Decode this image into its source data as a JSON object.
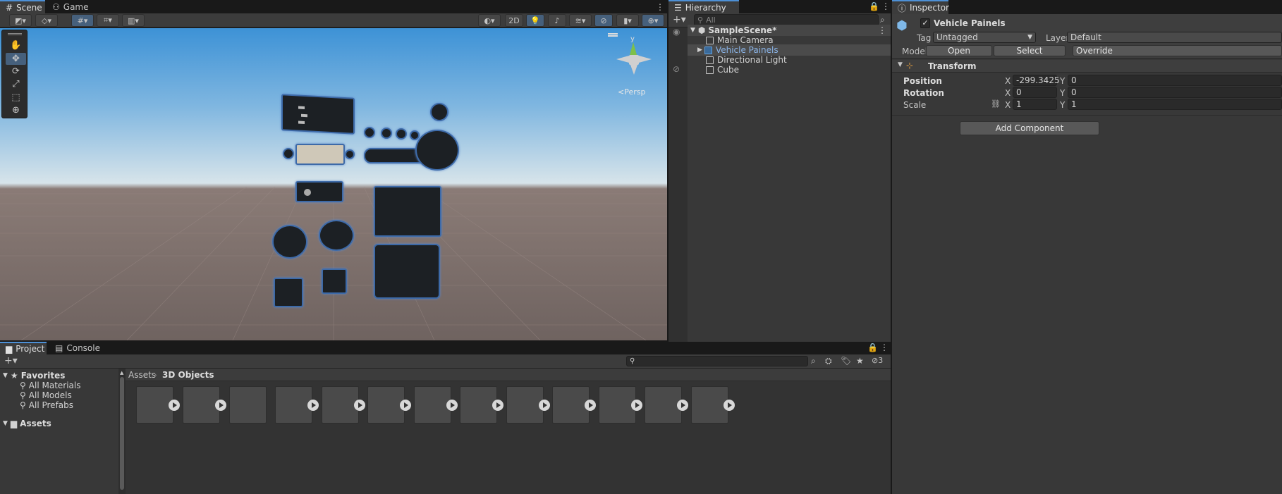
{
  "scene_tabs": {
    "scene": "Scene",
    "game": "Game"
  },
  "scene_toolbar": {
    "mode_2d": "2D"
  },
  "scene_view": {
    "projection": "<Persp",
    "axis_y": "y"
  },
  "hierarchy": {
    "title": "Hierarchy",
    "search_placeholder": "All",
    "scene_name": "SampleScene*",
    "items": [
      "Main Camera",
      "Vehicle Painels",
      "Directional Light",
      "Cube"
    ]
  },
  "inspector": {
    "title": "Inspector",
    "object_name": "Vehicle Painels",
    "tag_label": "Tag",
    "tag_value": "Untagged",
    "layer_label": "Layer",
    "layer_value": "Default",
    "model_label": "Model",
    "open_label": "Open",
    "select_label": "Select",
    "overrides_label": "Override",
    "transform_title": "Transform",
    "position_label": "Position",
    "rotation_label": "Rotation",
    "scale_label": "Scale",
    "x": "X",
    "y": "Y",
    "position_x": "-299.3425",
    "position_y": "0",
    "rotation_x": "0",
    "rotation_y": "0",
    "scale_x": "1",
    "scale_y": "1",
    "add_component": "Add Component"
  },
  "bottom_tabs": {
    "project": "Project",
    "console": "Console"
  },
  "project": {
    "favorites": "Favorites",
    "favorite_items": [
      "All Materials",
      "All Models",
      "All Prefabs"
    ],
    "assets": "Assets",
    "breadcrumb_root": "Assets",
    "breadcrumb_folder": "3D Objects",
    "hidden_count": "3"
  },
  "colors": {
    "accent": "#4d90d6",
    "selection": "#46607c",
    "panel": "#383838",
    "bg": "#191919"
  }
}
